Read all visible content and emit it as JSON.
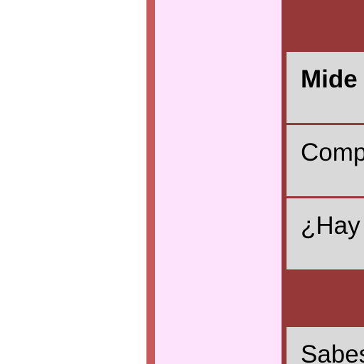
{
  "table": {
    "rows": [
      {
        "text": "Mide",
        "bold": true
      },
      {
        "text": "Comp",
        "bold": false
      },
      {
        "text": "¿Hay",
        "bold": false
      },
      {
        "text": "Sabes",
        "bold": false
      }
    ]
  },
  "colors": {
    "rule": "#c9585a",
    "column": "#fde4fc",
    "header": "#973838",
    "row": "#d9d9d9"
  }
}
